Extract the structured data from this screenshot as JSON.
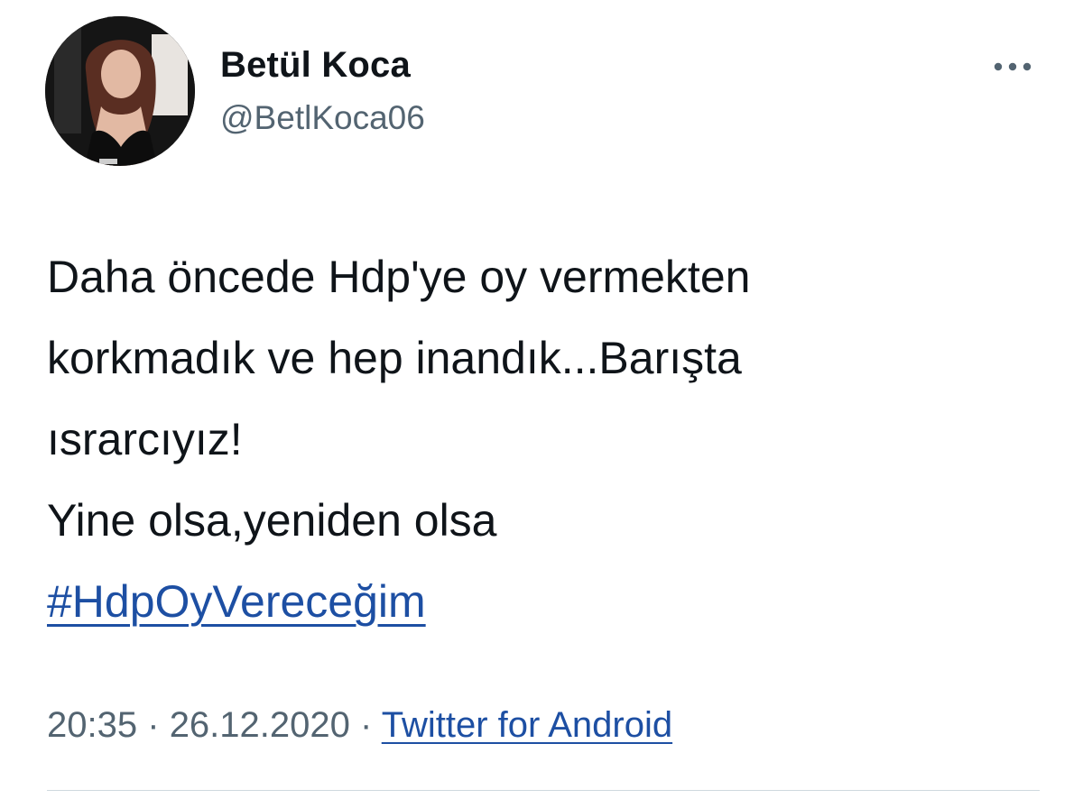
{
  "tweet": {
    "author": {
      "name": "Betül Koca",
      "handle": "@BetlKoca06",
      "avatar_icon": "profile-photo"
    },
    "more_icon": "more-options-icon",
    "text_lines": [
      "Daha öncede Hdp'ye oy vermekten",
      "korkmadık ve hep inandık...Barışta",
      "ısrarcıyız!",
      "Yine olsa,yeniden olsa"
    ],
    "hashtag": "#HdpOyVereceğim",
    "time": "20:35",
    "separator": "·",
    "date": "26.12.2020",
    "source": "Twitter for Android"
  },
  "colors": {
    "text": "#0f1419",
    "secondary": "#536471",
    "link": "#1d4fa3",
    "divider": "#cfd9de"
  }
}
